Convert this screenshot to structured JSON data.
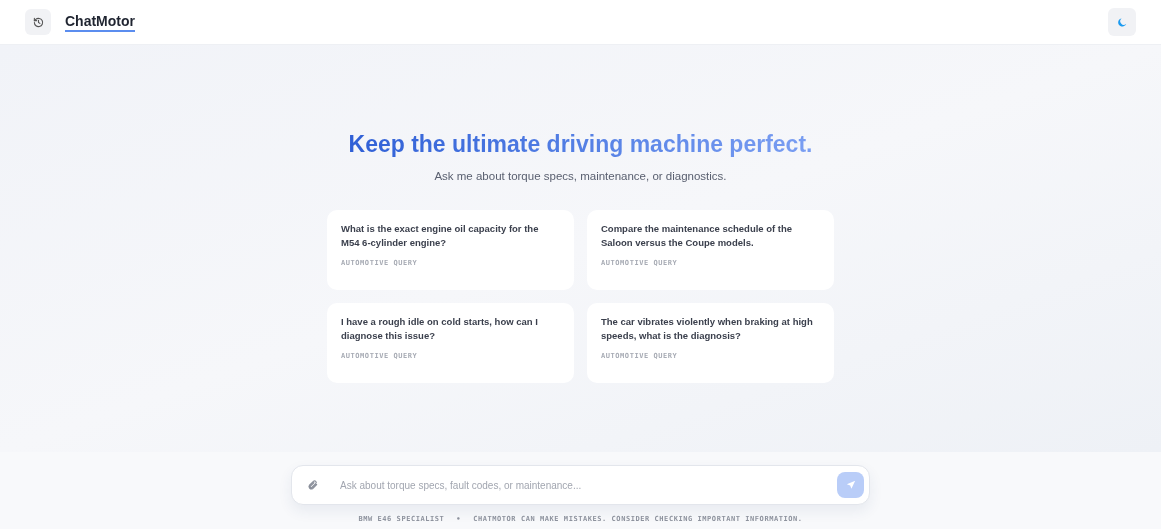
{
  "header": {
    "title": "ChatMotor"
  },
  "hero": {
    "heading": "Keep the ultimate driving machine perfect.",
    "subtitle": "Ask me about torque specs, maintenance, or diagnostics."
  },
  "suggestions": [
    {
      "text": "What is the exact engine oil capacity for the M54 6-cylinder engine?",
      "tag": "AUTOMOTIVE QUERY"
    },
    {
      "text": "Compare the maintenance schedule of the Saloon versus the Coupe models.",
      "tag": "AUTOMOTIVE QUERY"
    },
    {
      "text": "I have a rough idle on cold starts, how can I diagnose this issue?",
      "tag": "AUTOMOTIVE QUERY"
    },
    {
      "text": "The car vibrates violently when braking at high speeds, what is the diagnosis?",
      "tag": "AUTOMOTIVE QUERY"
    }
  ],
  "composer": {
    "placeholder": "Ask about torque specs, fault codes, or maintenance...",
    "send_disabled": true
  },
  "footer": {
    "items": [
      "BMW E46 SPECIALIST",
      "•",
      "CHATMOTOR CAN MAKE MISTAKES. CONSIDER CHECKING IMPORTANT INFORMATION."
    ]
  }
}
